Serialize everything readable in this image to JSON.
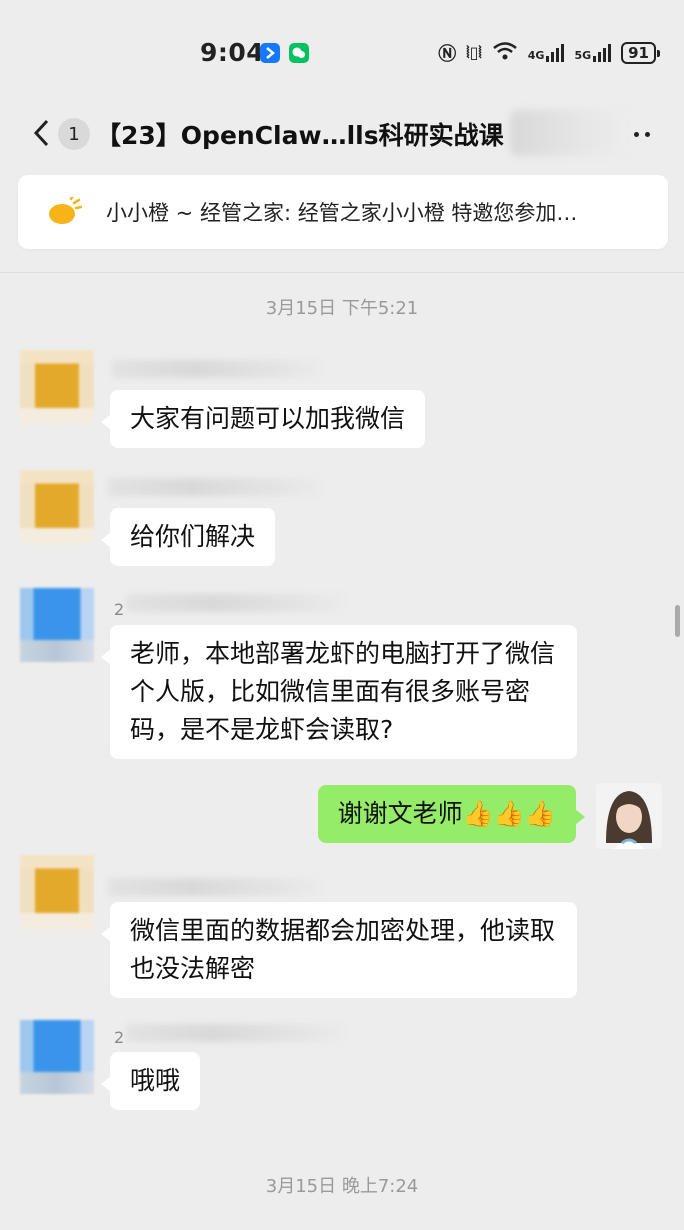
{
  "status_bar": {
    "time": "9:04",
    "network_4g": "4G",
    "network_5g": "5G",
    "battery": "91",
    "icons": [
      "nfc-icon",
      "vibrate-icon",
      "wifi-icon",
      "signal-icon",
      "battery-icon"
    ]
  },
  "nav": {
    "unread_count": "1",
    "title": "【23】OpenClaw…lls科研实战课"
  },
  "announcement": {
    "text": "小小橙 ~ 经管之家: 经管之家小小橙 特邀您参加…"
  },
  "timestamps": {
    "top": "3月15日 下午5:21",
    "bottom": "3月15日 晚上7:24"
  },
  "messages": [
    {
      "side": "left",
      "avatar": "orange",
      "text": "大家有问题可以加我微信"
    },
    {
      "side": "left",
      "avatar": "orange",
      "text": "给你们解决"
    },
    {
      "side": "left",
      "avatar": "blue",
      "name_prefix": "2",
      "text": "老师，本地部署龙虾的电脑打开了微信个人版，比如微信里面有很多账号密码，是不是龙虾会读取?"
    },
    {
      "side": "right",
      "text": "谢谢文老师👍👍👍"
    },
    {
      "side": "left",
      "avatar": "orange",
      "text": "微信里面的数据都会加密处理，他读取也没法解密"
    },
    {
      "side": "left",
      "avatar": "blue",
      "name_prefix": "2",
      "text": "哦哦"
    }
  ],
  "colors": {
    "background": "#ededed",
    "self_bubble": "#95ec69",
    "other_bubble": "#ffffff"
  }
}
